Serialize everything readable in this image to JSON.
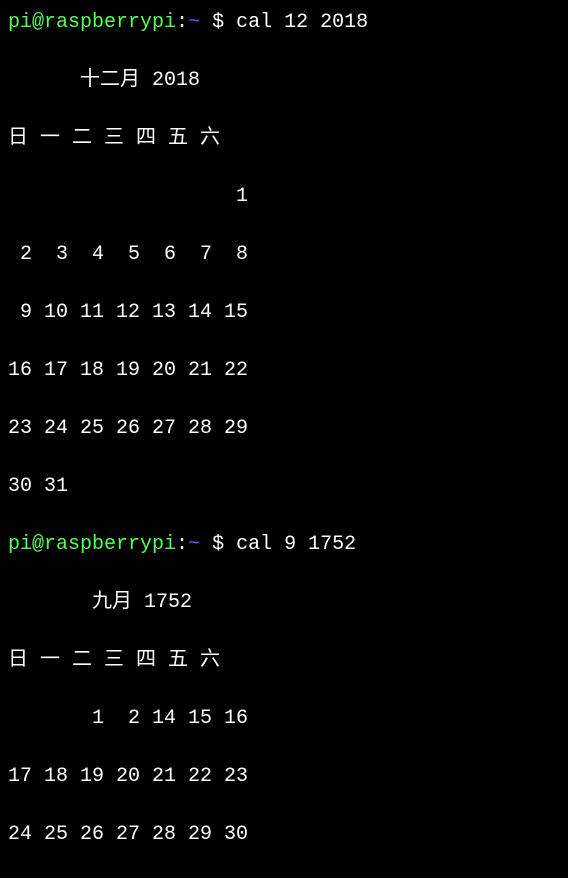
{
  "prompt1": {
    "user_host": "pi@raspberrypi",
    "colon": ":",
    "path": "~",
    "dollar": " $ ",
    "command": "cal 12 2018"
  },
  "cal1": {
    "title": "      十二月 2018",
    "weekdays": "日 一 二 三 四 五 六",
    "rows": [
      "                   1",
      " 2  3  4  5  6  7  8",
      " 9 10 11 12 13 14 15",
      "16 17 18 19 20 21 22",
      "23 24 25 26 27 28 29",
      "30 31"
    ]
  },
  "prompt2": {
    "user_host": "pi@raspberrypi",
    "colon": ":",
    "path": "~",
    "dollar": " $ ",
    "command": "cal 9 1752"
  },
  "cal2": {
    "title": "       九月 1752",
    "weekdays": "日 一 二 三 四 五 六",
    "rows": [
      "       1  2 14 15 16",
      "17 18 19 20 21 22 23",
      "24 25 26 27 28 29 30"
    ]
  },
  "chart_data": [
    {
      "type": "table",
      "title": "十二月 2018",
      "categories": [
        "日",
        "一",
        "二",
        "三",
        "四",
        "五",
        "六"
      ],
      "values": [
        [
          null,
          null,
          null,
          null,
          null,
          null,
          1
        ],
        [
          2,
          3,
          4,
          5,
          6,
          7,
          8
        ],
        [
          9,
          10,
          11,
          12,
          13,
          14,
          15
        ],
        [
          16,
          17,
          18,
          19,
          20,
          21,
          22
        ],
        [
          23,
          24,
          25,
          26,
          27,
          28,
          29
        ],
        [
          30,
          31,
          null,
          null,
          null,
          null,
          null
        ]
      ]
    },
    {
      "type": "table",
      "title": "九月 1752",
      "categories": [
        "日",
        "一",
        "二",
        "三",
        "四",
        "五",
        "六"
      ],
      "values": [
        [
          null,
          null,
          1,
          2,
          14,
          15,
          16
        ],
        [
          17,
          18,
          19,
          20,
          21,
          22,
          23
        ],
        [
          24,
          25,
          26,
          27,
          28,
          29,
          30
        ]
      ]
    }
  ]
}
